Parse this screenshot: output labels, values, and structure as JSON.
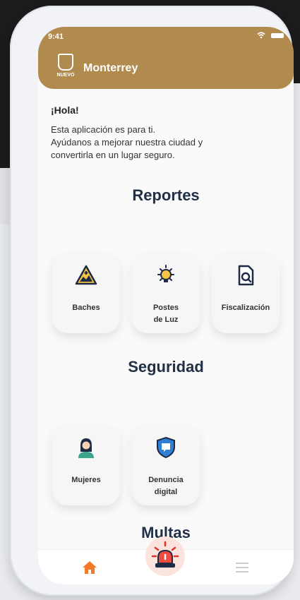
{
  "status": {
    "time": "9:41"
  },
  "header": {
    "title": "Monterrey",
    "logo_text": "NUEVO"
  },
  "greeting": {
    "title": "¡Hola!",
    "lines": [
      "Esta aplicación es para ti.",
      "Ayúdanos a mejorar nuestra ciudad y",
      "convertirla en un lugar seguro."
    ]
  },
  "sections": {
    "reportes": {
      "title": "Reportes",
      "items": [
        {
          "label1": "Baches",
          "label2": "",
          "icon": "pothole-warning-icon"
        },
        {
          "label1": "Postes",
          "label2": "de Luz",
          "icon": "lightbulb-icon"
        },
        {
          "label1": "Fiscalización",
          "label2": "",
          "icon": "document-search-icon"
        }
      ]
    },
    "seguridad": {
      "title": "Seguridad",
      "items": [
        {
          "label1": "Mujeres",
          "label2": "",
          "icon": "woman-icon"
        },
        {
          "label1": "Denuncia",
          "label2": "digital",
          "icon": "chat-alert-shield-icon"
        }
      ]
    },
    "multas": {
      "title": "Multas"
    }
  },
  "colors": {
    "brand": "#b18b4e",
    "accent": "#f47b2a",
    "heading": "#223047"
  }
}
